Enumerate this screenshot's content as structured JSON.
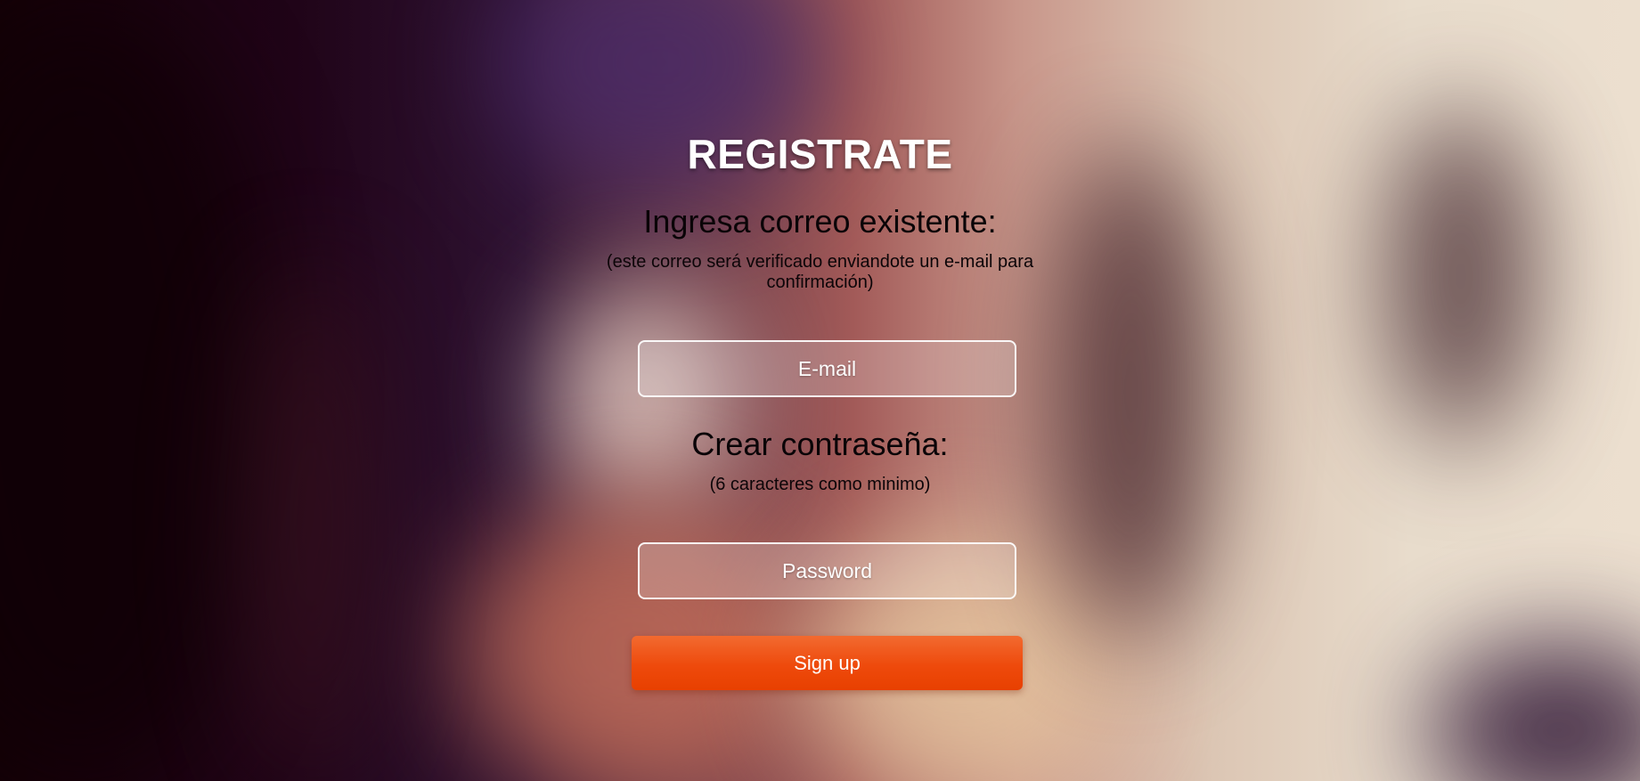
{
  "page": {
    "title": "REGISTRATE",
    "email_section": {
      "heading": "Ingresa correo existente:",
      "note": "(este correo será verificado enviandote un e-mail para confirmación)",
      "input_placeholder": "E-mail",
      "input_value": ""
    },
    "password_section": {
      "heading": "Crear contraseña:",
      "note": "(6 caracteres como minimo)",
      "input_placeholder": "Password",
      "input_value": ""
    },
    "submit_label": "Sign up"
  },
  "colors": {
    "button": "#ee4a0c",
    "title": "#ffffff",
    "heading_text": "#0a0407"
  }
}
